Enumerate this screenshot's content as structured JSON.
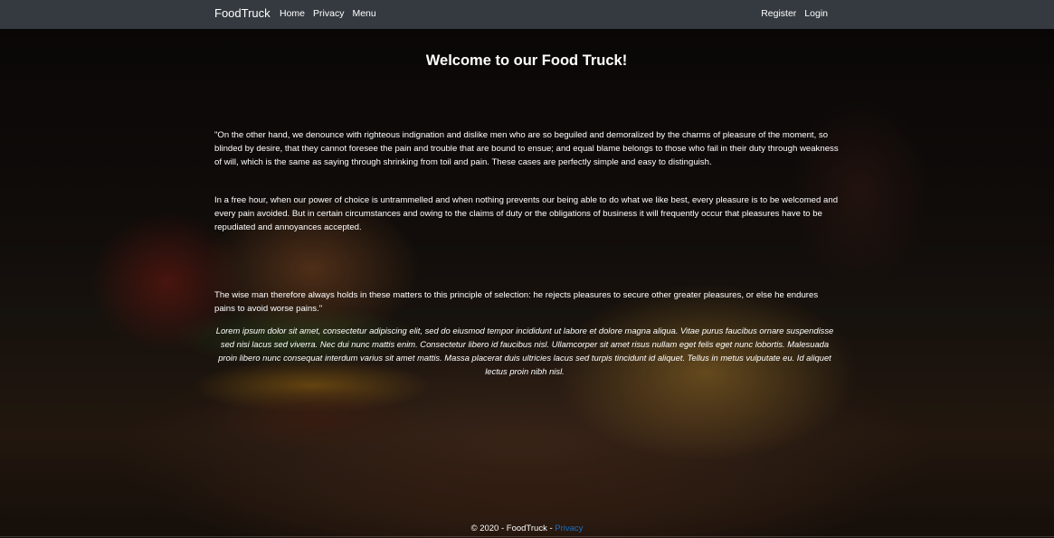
{
  "navbar": {
    "brand": "FoodTruck",
    "left_links": [
      "Home",
      "Privacy",
      "Menu"
    ],
    "right_links": [
      "Register",
      "Login"
    ]
  },
  "main": {
    "title": "Welcome to our Food Truck!",
    "paragraphs": [
      "\"On the other hand, we denounce with righteous indignation and dislike men who are so beguiled and demoralized by the charms of pleasure of the moment, so blinded by desire, that they cannot foresee the pain and trouble that are bound to ensue; and equal blame belongs to those who fail in their duty through weakness of will, which is the same as saying through shrinking from toil and pain. These cases are perfectly simple and easy to distinguish.",
      "In a free hour, when our power of choice is untrammelled and when nothing prevents our being able to do what we like best, every pleasure is to be welcomed and every pain avoided. But in certain circumstances and owing to the claims of duty or the obligations of business it will frequently occur that pleasures have to be repudiated and annoyances accepted.",
      "The wise man therefore always holds in these matters to this principle of selection: he rejects pleasures to secure other greater pleasures, or else he endures pains to avoid worse pains.\""
    ],
    "lorem": "Lorem ipsum dolor sit amet, consectetur adipiscing elit, sed do eiusmod tempor incididunt ut labore et dolore magna aliqua. Vitae purus faucibus ornare suspendisse sed nisi lacus sed viverra. Nec dui nunc mattis enim. Consectetur libero id faucibus nisl. Ullamcorper sit amet risus nullam eget felis eget nunc lobortis. Malesuada proin libero nunc consequat interdum varius sit amet mattis. Massa placerat duis ultricies lacus sed turpis tincidunt id aliquet. Tellus in metus vulputate eu. Id aliquet lectus proin nibh nisl."
  },
  "footer": {
    "text": "© 2020 - FoodTruck - ",
    "privacy_link": "Privacy"
  },
  "colors": {
    "navbar_bg": "#343a40",
    "link_blue": "#1b6ec2",
    "text": "#ffffff"
  }
}
